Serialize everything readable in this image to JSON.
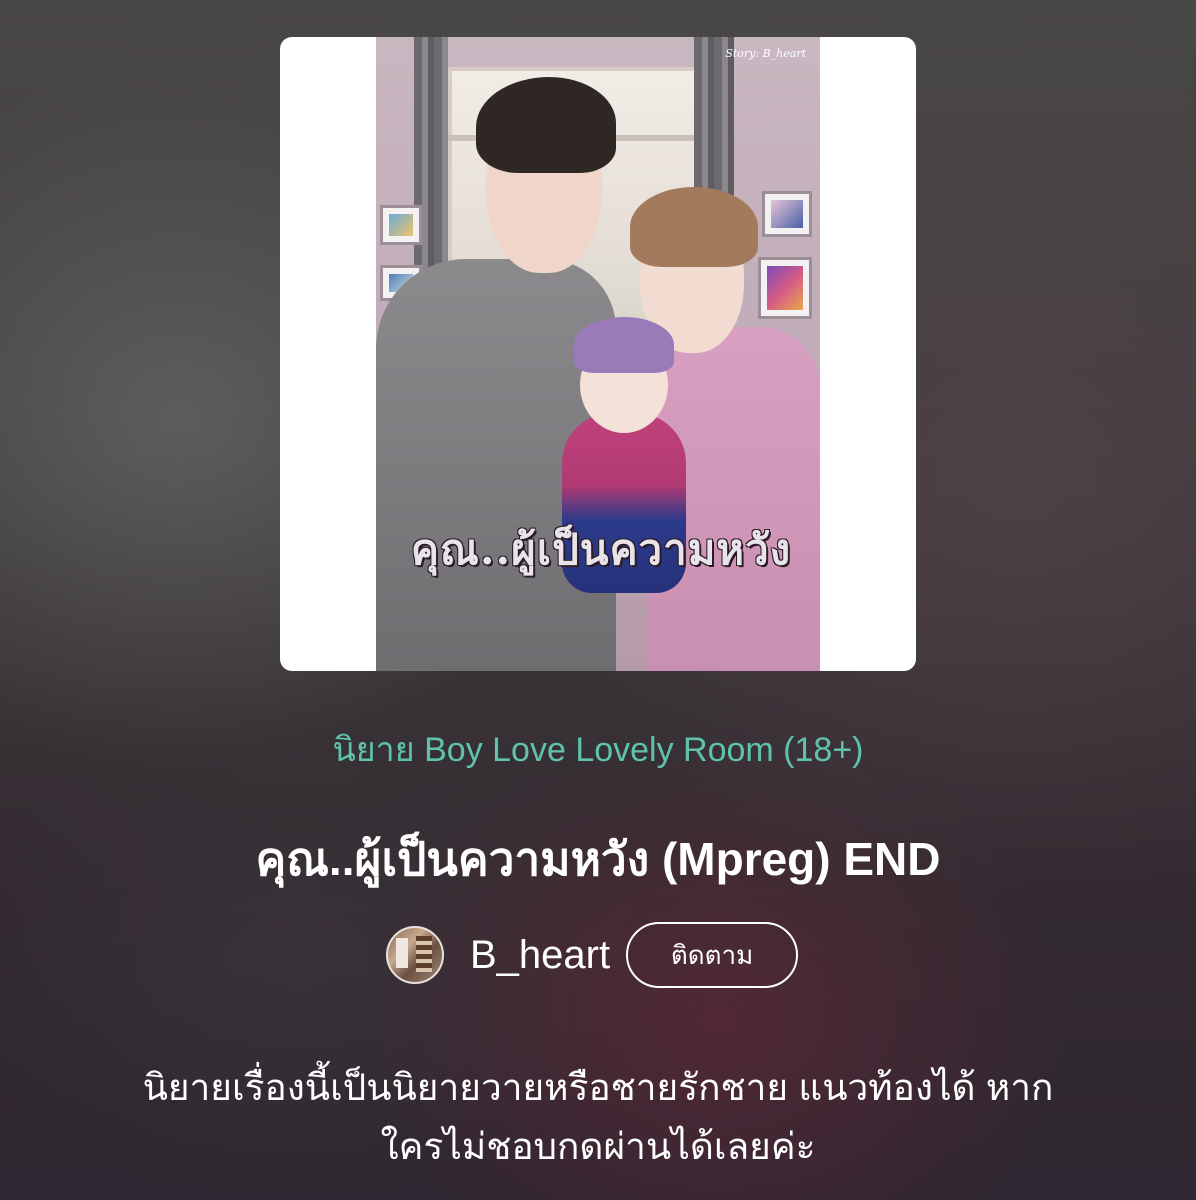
{
  "cover": {
    "title_text": "คุณ..ผู้เป็นความหวัง",
    "credit_text": "Story: B_heart"
  },
  "category_label": "นิยาย Boy Love Lovely Room (18+)",
  "story_title": "คุณ..ผู้เป็นความหวัง (Mpreg) END",
  "author": {
    "name": "B_heart",
    "follow_label": "ติดตาม"
  },
  "description": {
    "line1": "นิยายเรื่องนี้เป็นนิยายวายหรือชายรักชาย แนวท้องได้  หาก",
    "line2": "ใครไม่ชอบกดผ่านได้เลยค่ะ"
  },
  "colors": {
    "accent": "#5fc2aa",
    "text": "#ffffff"
  }
}
